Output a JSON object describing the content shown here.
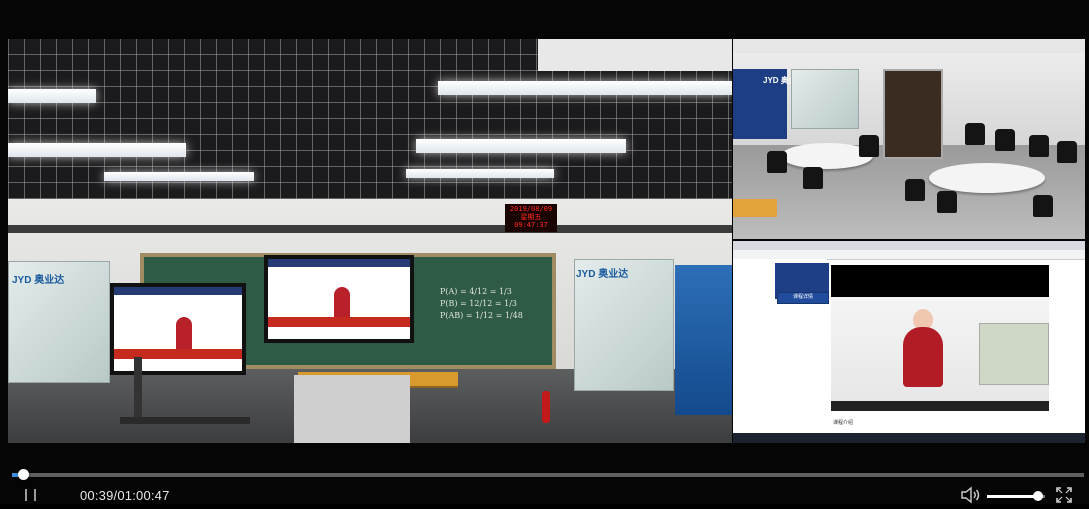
{
  "player": {
    "current_time": "00:39",
    "duration": "01:00:47",
    "time_display": "00:39/01:00:47",
    "progress_fraction": 0.0107,
    "volume_fraction": 0.88,
    "icons": [
      "pause-icon",
      "volume-icon",
      "fullscreen-icon"
    ],
    "colors": {
      "seek_played": "#3d8fe0",
      "background": "#050505",
      "text": "#e8e8e8"
    }
  },
  "main_video": {
    "brand_logo": "JYD 奥业达",
    "led_clock": {
      "date": "2019/08/09",
      "day": "星期五",
      "time": "09:47:37"
    },
    "chalkboard_lines": [
      "P(A) = 4/12 = 1/3",
      "P(B) = 12/12 = 1/3",
      "P(AB) = 1/12 = 1/48"
    ]
  },
  "inset_top": {
    "brand_logo": "JYD 奥业达"
  },
  "inset_bottom": {
    "course_button": "课程详情",
    "section_label": "课程介绍"
  }
}
